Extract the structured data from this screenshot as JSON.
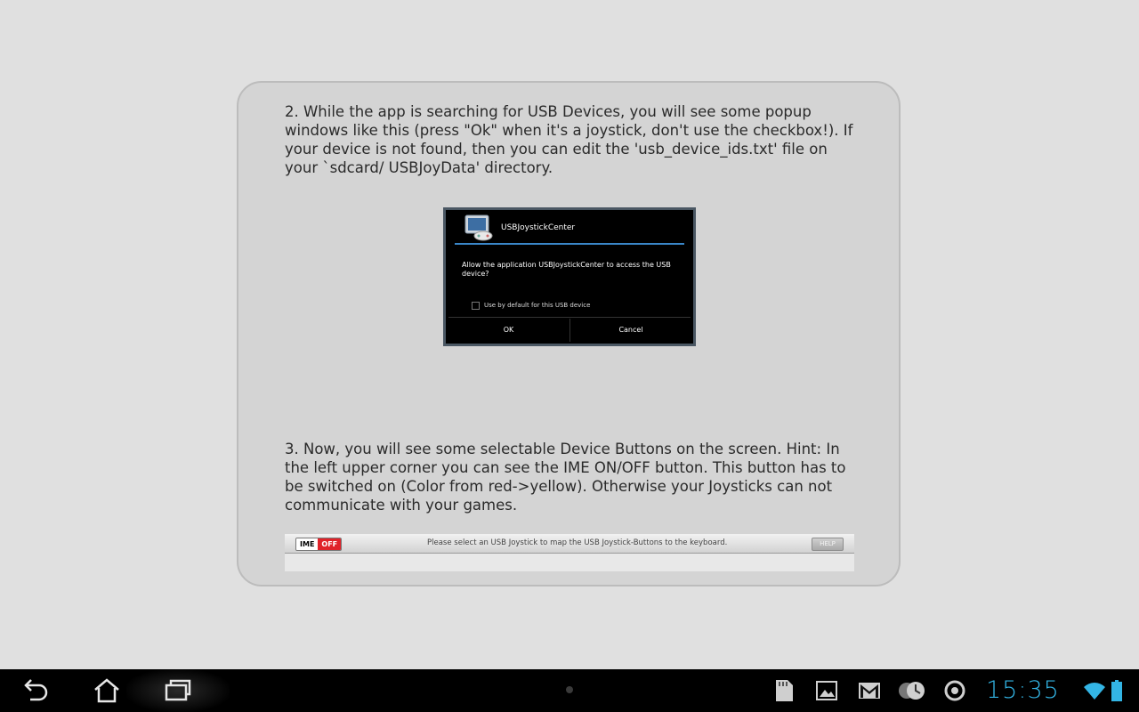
{
  "instructions": {
    "step2_text": "2. While the app is searching for USB Devices, you will see some popup windows like this (press \"Ok\" when it's a joystick, don't use the checkbox!). If your device is not found, then you can edit the 'usb_device_ids.txt' file on your `sdcard/ USBJoyData' directory.",
    "step3_text": "3. Now, you will see some selectable Device Buttons on the screen. Hint: In the left upper corner you can see the IME ON/OFF button. This button has to be switched on (Color from red->yellow). Otherwise your Joysticks can not communicate with your games."
  },
  "usb_dialog": {
    "title": "USBJoystickCenter",
    "message": "Allow the application USBJoystickCenter to access the USB device?",
    "checkbox_label": "Use by default for this USB device",
    "ok_label": "OK",
    "cancel_label": "Cancel",
    "icon": "monitor-joystick-icon"
  },
  "ime_bar": {
    "ime_label": "IME",
    "state_label": "OFF",
    "state_color": "#e0232a",
    "message": "Please select an USB Joystick to map the USB Joystick-Buttons to the keyboard.",
    "help_label": "HELP"
  },
  "system_bar": {
    "clock": "15:35",
    "clock_color": "#33b5e5",
    "nav_icons": [
      "back-icon",
      "home-icon",
      "recent-apps-icon"
    ],
    "status_icons": [
      "sd-card-icon",
      "gallery-icon",
      "gmail-icon",
      "clock-sync-icon",
      "app-icon",
      "wifi-icon",
      "battery-icon"
    ]
  }
}
